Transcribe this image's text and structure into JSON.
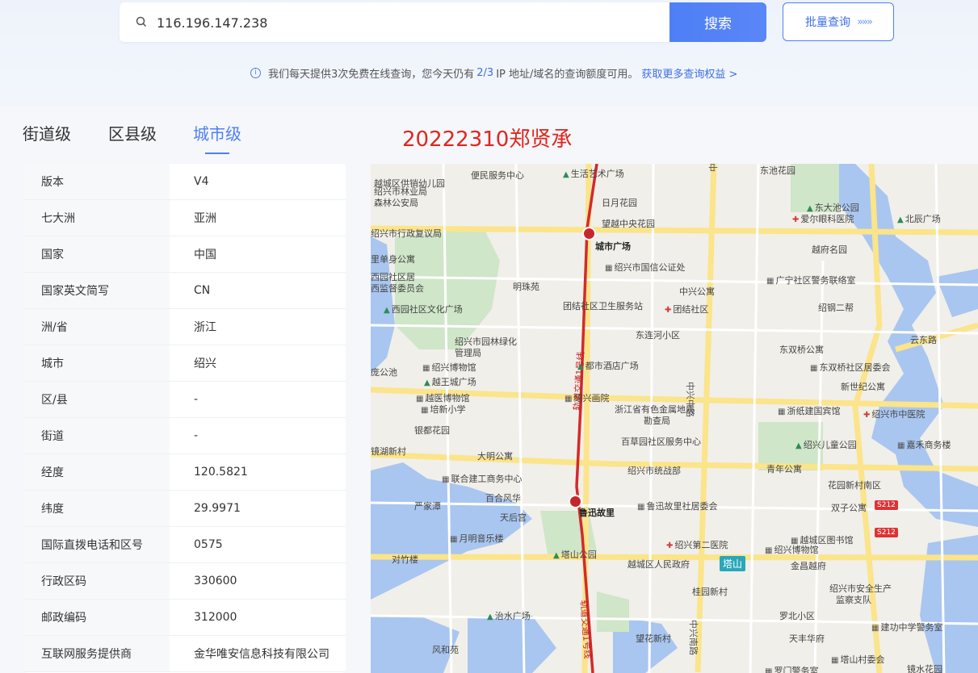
{
  "search": {
    "value": "116.196.147.238",
    "button_label": "搜索",
    "batch_label": "批量查询",
    "batch_arrows": "»»»"
  },
  "notice": {
    "icon": "info-icon",
    "prefix": "我们每天提供3次免费在线查询，您今天仍有",
    "quota": "2/3",
    "suffix": "IP 地址/域名的查询额度可用。",
    "link": "获取更多查询权益 >"
  },
  "tabs": [
    {
      "label": "街道级",
      "active": false
    },
    {
      "label": "区县级",
      "active": false
    },
    {
      "label": "城市级",
      "active": true
    }
  ],
  "watermark": "20222310郑贤承",
  "info_rows": [
    {
      "key": "版本",
      "value": "V4"
    },
    {
      "key": "七大洲",
      "value": "亚洲"
    },
    {
      "key": "国家",
      "value": "中国"
    },
    {
      "key": "国家英文简写",
      "value": "CN"
    },
    {
      "key": "洲/省",
      "value": "浙江"
    },
    {
      "key": "城市",
      "value": "绍兴"
    },
    {
      "key": "区/县",
      "value": "-"
    },
    {
      "key": "街道",
      "value": "-"
    },
    {
      "key": "经度",
      "value": "120.5821"
    },
    {
      "key": "纬度",
      "value": "29.9971"
    },
    {
      "key": "国际直拨电话和区号",
      "value": "0575"
    },
    {
      "key": "行政区码",
      "value": "330600"
    },
    {
      "key": "邮政编码",
      "value": "312000"
    },
    {
      "key": "互联网服务提供商",
      "value": "金华唯安信息科技有限公司"
    }
  ],
  "map": {
    "pois": [
      {
        "id": "p1",
        "text": "越城区供销幼儿园",
        "type": "plain"
      },
      {
        "id": "p2",
        "text": "便民服务中心",
        "type": "plain"
      },
      {
        "id": "p3",
        "text": "生活艺术广场",
        "type": "park"
      },
      {
        "id": "p4",
        "text": "东池花园",
        "type": "plain"
      },
      {
        "id": "p5",
        "text": "绍兴市林业局",
        "type": "plain"
      },
      {
        "id": "p6",
        "text": "森林公安局",
        "type": "plain"
      },
      {
        "id": "p7",
        "text": "日月花园",
        "type": "plain"
      },
      {
        "id": "p8",
        "text": "东大池公园",
        "type": "park"
      },
      {
        "id": "p9",
        "text": "爱尔眼科医院",
        "type": "hosp"
      },
      {
        "id": "p10",
        "text": "北辰广场",
        "type": "park"
      },
      {
        "id": "p11",
        "text": "望越中央花园",
        "type": "plain"
      },
      {
        "id": "p12",
        "text": "绍兴市行政复议局",
        "type": "plain"
      },
      {
        "id": "p13",
        "text": "城市广场",
        "type": "dark"
      },
      {
        "id": "p14",
        "text": "越府名园",
        "type": "plain"
      },
      {
        "id": "p15",
        "text": "里单身公寓",
        "type": "plain"
      },
      {
        "id": "p16",
        "text": "绍兴市国信公证处",
        "type": "bld"
      },
      {
        "id": "p17",
        "text": "西园社区居",
        "type": "plain"
      },
      {
        "id": "p18",
        "text": "西监督委员会",
        "type": "plain"
      },
      {
        "id": "p19",
        "text": "明珠苑",
        "type": "plain"
      },
      {
        "id": "p20",
        "text": "中兴公寓",
        "type": "plain"
      },
      {
        "id": "p21",
        "text": "广宁社区警务联络室",
        "type": "bld"
      },
      {
        "id": "p22",
        "text": "西园社区文化广场",
        "type": "park"
      },
      {
        "id": "p23",
        "text": "团结社区卫生服务站",
        "type": "plain"
      },
      {
        "id": "p24",
        "text": "团结社区",
        "type": "hosp"
      },
      {
        "id": "p25",
        "text": "绍钢二帮",
        "type": "plain"
      },
      {
        "id": "p26",
        "text": "东连河小区",
        "type": "plain"
      },
      {
        "id": "p27",
        "text": "绍兴市园林绿化",
        "type": "plain"
      },
      {
        "id": "p28",
        "text": "管理局",
        "type": "plain"
      },
      {
        "id": "p29",
        "text": "东双桥公寓",
        "type": "plain"
      },
      {
        "id": "p30",
        "text": "云东路",
        "type": "road"
      },
      {
        "id": "p31",
        "text": "绍兴博物馆",
        "type": "bld"
      },
      {
        "id": "p32",
        "text": "都市酒店广场",
        "type": "park"
      },
      {
        "id": "p33",
        "text": "东双桥社区居委会",
        "type": "bld"
      },
      {
        "id": "p34",
        "text": "庞公池",
        "type": "plain"
      },
      {
        "id": "p35",
        "text": "越王城广场",
        "type": "park"
      },
      {
        "id": "p36",
        "text": "新世纪公寓",
        "type": "plain"
      },
      {
        "id": "p37",
        "text": "越医博物馆",
        "type": "bld"
      },
      {
        "id": "p38",
        "text": "绍兴画院",
        "type": "bld"
      },
      {
        "id": "p39",
        "text": "培新小学",
        "type": "bld"
      },
      {
        "id": "p40",
        "text": "浙江省有色金属地质",
        "type": "plain"
      },
      {
        "id": "p41",
        "text": "勘查局",
        "type": "plain"
      },
      {
        "id": "p42",
        "text": "浙纸建国宾馆",
        "type": "bld"
      },
      {
        "id": "p43",
        "text": "绍兴市中医院",
        "type": "hosp"
      },
      {
        "id": "p44",
        "text": "银都花园",
        "type": "plain"
      },
      {
        "id": "p45",
        "text": "百草园社区服务中心",
        "type": "plain"
      },
      {
        "id": "p46",
        "text": "绍兴儿童公园",
        "type": "park"
      },
      {
        "id": "p47",
        "text": "嘉禾商务楼",
        "type": "bld"
      },
      {
        "id": "p48",
        "text": "镜湖新村",
        "type": "plain"
      },
      {
        "id": "p49",
        "text": "大明公寓",
        "type": "plain"
      },
      {
        "id": "p50",
        "text": "绍兴市统战部",
        "type": "plain"
      },
      {
        "id": "p51",
        "text": "青年公寓",
        "type": "plain"
      },
      {
        "id": "p52",
        "text": "联合建工商务中心",
        "type": "bld"
      },
      {
        "id": "p53",
        "text": "花园新村南区",
        "type": "plain"
      },
      {
        "id": "p54",
        "text": "百合风华",
        "type": "plain"
      },
      {
        "id": "p55",
        "text": "严家潭",
        "type": "plain"
      },
      {
        "id": "p56",
        "text": "鲁迅故里",
        "type": "dark"
      },
      {
        "id": "p57",
        "text": "鲁迅故里社居委会",
        "type": "bld"
      },
      {
        "id": "p58",
        "text": "天后宫",
        "type": "plain"
      },
      {
        "id": "p59",
        "text": "双子公寓",
        "type": "plain"
      },
      {
        "id": "p60",
        "text": "月明音乐楼",
        "type": "bld"
      },
      {
        "id": "p61",
        "text": "绍兴第二医院",
        "type": "hosp"
      },
      {
        "id": "p62",
        "text": "越城区图书馆",
        "type": "bld"
      },
      {
        "id": "p63",
        "text": "对竹楼",
        "type": "plain"
      },
      {
        "id": "p64",
        "text": "塔山公园",
        "type": "park"
      },
      {
        "id": "p65",
        "text": "越城区人民政府",
        "type": "plain"
      },
      {
        "id": "p66",
        "text": "绍兴博物馆",
        "type": "bld"
      },
      {
        "id": "p67",
        "text": "金昌越府",
        "type": "plain"
      },
      {
        "id": "p68",
        "text": "绍兴市安全生产",
        "type": "plain"
      },
      {
        "id": "p69",
        "text": "监察支队",
        "type": "plain"
      },
      {
        "id": "p70",
        "text": "桂园新村",
        "type": "plain"
      },
      {
        "id": "p71",
        "text": "治水广场",
        "type": "park"
      },
      {
        "id": "p72",
        "text": "罗北小区",
        "type": "plain"
      },
      {
        "id": "p73",
        "text": "建功中学警务室",
        "type": "bld"
      },
      {
        "id": "p74",
        "text": "望花新村",
        "type": "plain"
      },
      {
        "id": "p75",
        "text": "天丰华府",
        "type": "plain"
      },
      {
        "id": "p76",
        "text": "风和苑",
        "type": "plain"
      },
      {
        "id": "p77",
        "text": "塔山村委会",
        "type": "bld"
      },
      {
        "id": "p78",
        "text": "罗门警务室",
        "type": "bld"
      },
      {
        "id": "p79",
        "text": "镜水花园",
        "type": "plain"
      }
    ],
    "road_labels": [
      "中兴中路",
      "中兴中路",
      "中兴南路",
      "轨道交通1号线",
      "轨道交通1号线"
    ],
    "shields": [
      "S212",
      "S212"
    ],
    "tashan": "塔山"
  }
}
